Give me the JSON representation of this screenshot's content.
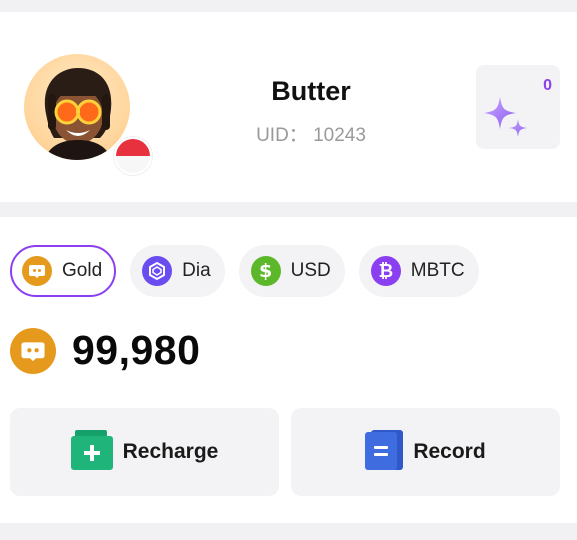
{
  "profile": {
    "name": "Butter",
    "uid": "UID： 10243",
    "avatar_icon": "memoji-avatar",
    "flag_icon": "indonesia-flag-icon",
    "sparkle_count": "0",
    "sparkle_icon": "sparkle-icon"
  },
  "wallet": {
    "tabs": [
      {
        "label": "Gold",
        "icon": "gold-coin-icon",
        "color": "#e69a1d",
        "active": true
      },
      {
        "label": "Dia",
        "icon": "diamond-icon",
        "color": "#6b4cf0",
        "active": false
      },
      {
        "label": "USD",
        "icon": "dollar-icon",
        "color": "#5cb82a",
        "active": false
      },
      {
        "label": "MBTC",
        "icon": "bitcoin-icon",
        "color": "#8a3ff0",
        "active": false
      }
    ],
    "balance": "99,980",
    "balance_icon": "gold-coin-icon",
    "actions": {
      "recharge_label": "Recharge",
      "recharge_icon": "recharge-wallet-icon",
      "record_label": "Record",
      "record_icon": "record-document-icon"
    }
  },
  "colors": {
    "accent": "#8a3ff0",
    "gold": "#e69a1d",
    "recharge": "#1fb47a",
    "record": "#3f6de0"
  }
}
